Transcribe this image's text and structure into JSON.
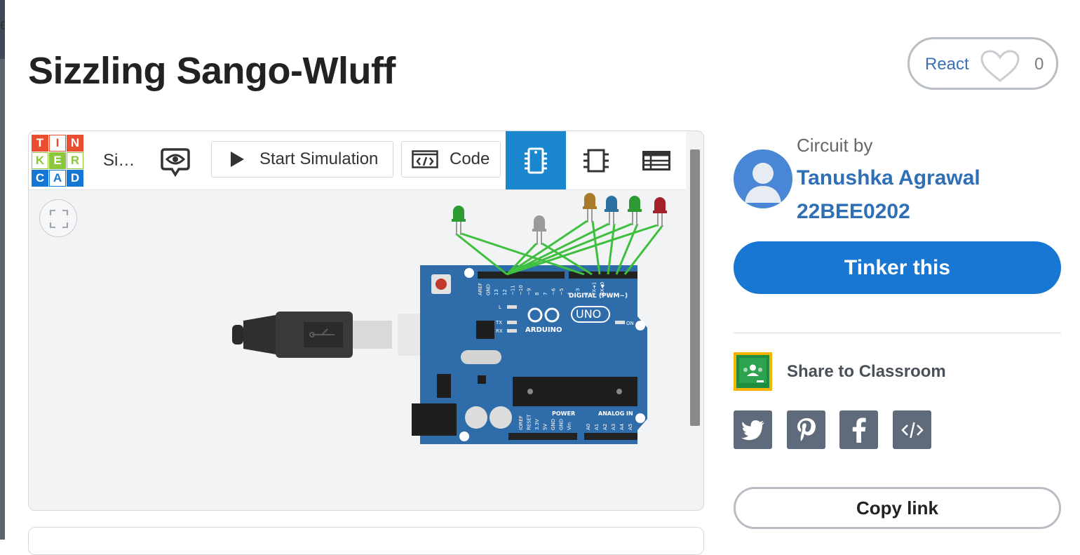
{
  "page": {
    "title": "Sizzling Sango-Wluff"
  },
  "react": {
    "label": "React",
    "count": "0"
  },
  "editor": {
    "logo_rows": [
      [
        "T",
        "I",
        "N"
      ],
      [
        "K",
        "E",
        "R"
      ],
      [
        "C",
        "A",
        "D"
      ]
    ],
    "sim_name": "Si…",
    "start_simulation_label": "Start Simulation",
    "code_label": "Code",
    "active_tab": "components",
    "board": {
      "top_labels": [
        "AREF",
        "GND",
        "13",
        "12",
        "~11",
        "~10",
        "~9",
        "8",
        "7",
        "~6",
        "~5",
        "4",
        "~3",
        "2",
        "TX➜1",
        "RX◀0"
      ],
      "digital_label": "DIGITAL (PWM~)",
      "brand": "ARDUINO",
      "model": "UNO",
      "on_label": "ON",
      "led_labels": [
        "L",
        "TX",
        "RX"
      ],
      "power_label": "POWER",
      "analog_label": "ANALOG IN",
      "power_pins": [
        "IOREF",
        "RESET",
        "3.3V",
        "5V",
        "GND",
        "GND",
        "Vin"
      ],
      "analog_pins": [
        "A0",
        "A1",
        "A2",
        "A3",
        "A4",
        "A5"
      ]
    },
    "leds": [
      {
        "color": "#2e9a33"
      },
      {
        "color": "#9a9a9a"
      },
      {
        "color": "#a87a2a"
      },
      {
        "color": "#2a6fa0"
      },
      {
        "color": "#2e9a33"
      },
      {
        "color": "#a3222a"
      }
    ],
    "wire_color": "#3fbf3f"
  },
  "author": {
    "circuit_by_label": "Circuit by",
    "name": "Tanushka Agrawal",
    "id": "22BEE0202"
  },
  "actions": {
    "tinker_label": "Tinker this",
    "share_classroom_label": "Share to Classroom",
    "copy_link_label": "Copy link",
    "social_icons": [
      "twitter-icon",
      "pinterest-icon",
      "facebook-icon",
      "embed-code-icon"
    ]
  },
  "colors": {
    "primary": "#1877d2",
    "link": "#2f6fb5",
    "tab_active": "#1a87cf",
    "board": "#2f6daa"
  }
}
